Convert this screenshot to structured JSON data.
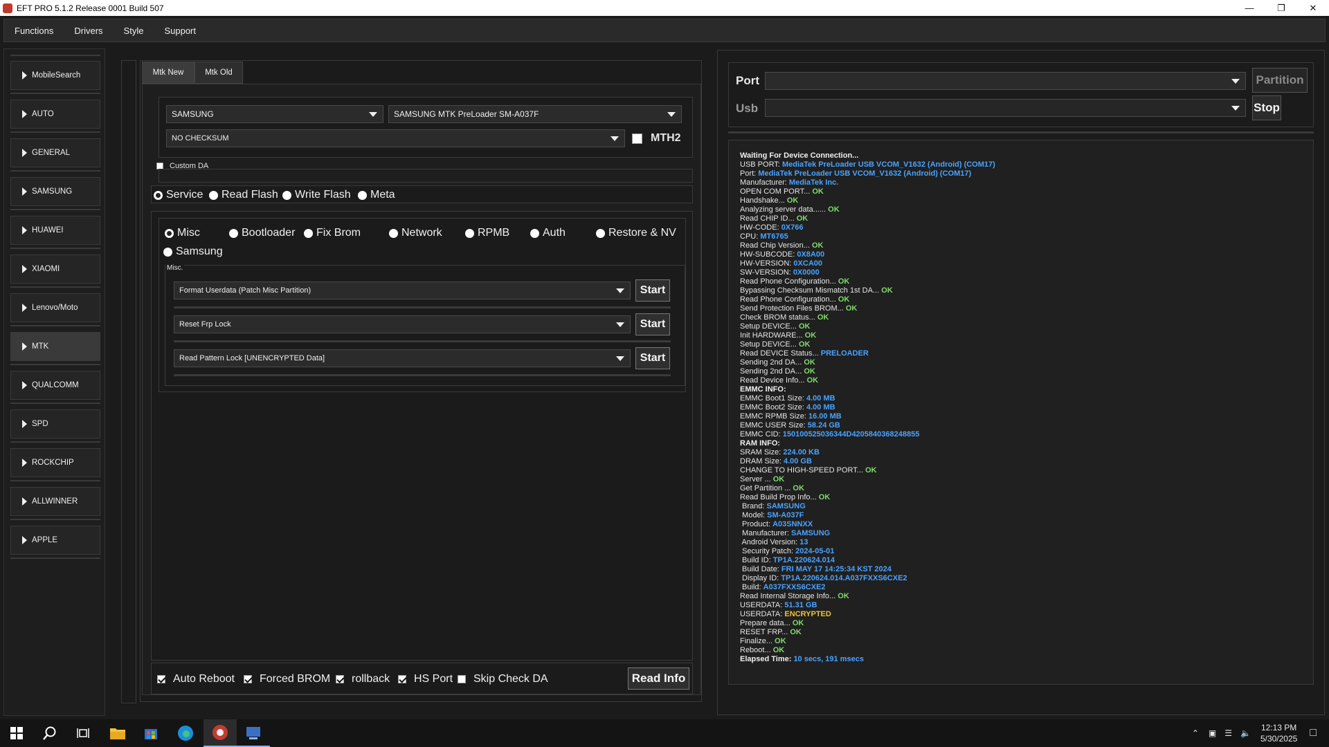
{
  "window": {
    "title": "EFT PRO 5.1.2 Release 0001 Build 507"
  },
  "menu": [
    "Functions",
    "Drivers",
    "Style",
    "Support"
  ],
  "sidebar": {
    "items": [
      {
        "label": "MobileSearch"
      },
      {
        "label": "AUTO"
      },
      {
        "label": "GENERAL"
      },
      {
        "label": "SAMSUNG"
      },
      {
        "label": "HUAWEI"
      },
      {
        "label": "XIAOMI"
      },
      {
        "label": "Lenovo/Moto"
      },
      {
        "label": "MTK"
      },
      {
        "label": "QUALCOMM"
      },
      {
        "label": "SPD"
      },
      {
        "label": "ROCKCHIP"
      },
      {
        "label": "ALLWINNER"
      },
      {
        "label": "APPLE"
      }
    ],
    "active": "MTK"
  },
  "tabs": {
    "mtk_new": "Mtk New",
    "mtk_old": "Mtk Old"
  },
  "config": {
    "brand": "SAMSUNG",
    "model": "SAMSUNG MTK PreLoader SM-A037F",
    "checksum": "NO CHECKSUM",
    "mth2_label": "MTH2",
    "custom_da_label": "Custom DA"
  },
  "modes": {
    "service": "Service",
    "read_flash": "Read Flash",
    "write_flash": "Write Flash",
    "meta": "Meta",
    "selected": "Service"
  },
  "categories": {
    "misc": "Misc",
    "bootloader": "Bootloader",
    "fix_brom": "Fix Brom",
    "network": "Network",
    "rpmb": "RPMB",
    "auth": "Auth",
    "restore_nv": "Restore & NV",
    "samsung": "Samsung",
    "selected": "Misc"
  },
  "misc": {
    "group_label": "Misc.",
    "op1": "Format Userdata (Patch Misc Partition)",
    "op2": "Reset Frp Lock",
    "op3": "Read Pattern Lock [UNENCRYPTED Data]",
    "start": "Start"
  },
  "options": {
    "auto_reboot": "Auto Reboot",
    "forced_brom": "Forced BROM",
    "rollback": "rollback",
    "hs_port": "HS Port",
    "skip_check_da": "Skip Check DA",
    "read_info": "Read Info"
  },
  "port": {
    "port_label": "Port",
    "usb_label": "Usb",
    "partition": "Partition",
    "stop": "Stop"
  },
  "colors": {
    "info_blue": "#4aa3ff",
    "ok_green": "#7fdc6a",
    "warn_yellow": "#f1c232"
  },
  "log": [
    [
      {
        "t": "Waiting For Device Connection...",
        "c": "h"
      }
    ],
    [
      {
        "t": "USB PORT: "
      },
      {
        "t": "MediaTek PreLoader USB VCOM_V1632 (Android) (COM17)",
        "c": "b"
      }
    ],
    [
      {
        "t": "Port: "
      },
      {
        "t": "MediaTek PreLoader USB VCOM_V1632 (Android) (COM17)",
        "c": "b"
      }
    ],
    [
      {
        "t": "Manufacturer: "
      },
      {
        "t": "MediaTek Inc.",
        "c": "b"
      }
    ],
    [
      {
        "t": "OPEN COM PORT... "
      },
      {
        "t": "OK",
        "c": "g"
      }
    ],
    [
      {
        "t": "Handshake... "
      },
      {
        "t": "OK",
        "c": "g"
      }
    ],
    [
      {
        "t": "Analyzing server data...... "
      },
      {
        "t": "OK",
        "c": "g"
      }
    ],
    [
      {
        "t": "Read CHIP ID... "
      },
      {
        "t": "OK",
        "c": "g"
      }
    ],
    [
      {
        "t": "HW-CODE: "
      },
      {
        "t": "0X766",
        "c": "b"
      }
    ],
    [
      {
        "t": "CPU: "
      },
      {
        "t": "MT6765",
        "c": "b"
      }
    ],
    [
      {
        "t": "Read Chip Version... "
      },
      {
        "t": "OK",
        "c": "g"
      }
    ],
    [
      {
        "t": "HW-SUBCODE: "
      },
      {
        "t": "0X8A00",
        "c": "b"
      }
    ],
    [
      {
        "t": "HW-VERSION: "
      },
      {
        "t": "0XCA00",
        "c": "b"
      }
    ],
    [
      {
        "t": "SW-VERSION: "
      },
      {
        "t": "0X0000",
        "c": "b"
      }
    ],
    [
      {
        "t": "Read Phone Configuration... "
      },
      {
        "t": "OK",
        "c": "g"
      }
    ],
    [
      {
        "t": "Bypassing Checksum Mismatch 1st DA... "
      },
      {
        "t": "OK",
        "c": "g"
      }
    ],
    [
      {
        "t": "Read Phone Configuration... "
      },
      {
        "t": "OK",
        "c": "g"
      }
    ],
    [
      {
        "t": "Send Protection Files BROM... "
      },
      {
        "t": "OK",
        "c": "g"
      }
    ],
    [
      {
        "t": "Check BROM status... "
      },
      {
        "t": "OK",
        "c": "g"
      }
    ],
    [
      {
        "t": "Setup DEVICE... "
      },
      {
        "t": "OK",
        "c": "g"
      }
    ],
    [
      {
        "t": "Init HARDWARE... "
      },
      {
        "t": "OK",
        "c": "g"
      }
    ],
    [
      {
        "t": "Setup DEVICE... "
      },
      {
        "t": "OK",
        "c": "g"
      }
    ],
    [
      {
        "t": "Read DEVICE Status... "
      },
      {
        "t": "PRELOADER",
        "c": "b"
      }
    ],
    [
      {
        "t": "Sending 2nd DA... "
      },
      {
        "t": "OK",
        "c": "g"
      }
    ],
    [
      {
        "t": "Sending 2nd DA... "
      },
      {
        "t": "OK",
        "c": "g"
      }
    ],
    [
      {
        "t": "Read Device Info... "
      },
      {
        "t": "OK",
        "c": "g"
      }
    ],
    [
      {
        "t": "EMMC INFO:",
        "c": "h"
      }
    ],
    [
      {
        "t": "EMMC Boot1 Size: "
      },
      {
        "t": "4.00 MB",
        "c": "b"
      }
    ],
    [
      {
        "t": "EMMC Boot2 Size: "
      },
      {
        "t": "4.00 MB",
        "c": "b"
      }
    ],
    [
      {
        "t": "EMMC RPMB Size: "
      },
      {
        "t": "16.00 MB",
        "c": "b"
      }
    ],
    [
      {
        "t": "EMMC USER Size: "
      },
      {
        "t": "58.24 GB",
        "c": "b"
      }
    ],
    [
      {
        "t": "EMMC CID: "
      },
      {
        "t": "150100525036344D4205840368248855",
        "c": "b"
      }
    ],
    [
      {
        "t": "RAM INFO:",
        "c": "h"
      }
    ],
    [
      {
        "t": "SRAM Size: "
      },
      {
        "t": "224.00 KB",
        "c": "b"
      }
    ],
    [
      {
        "t": "DRAM Size: "
      },
      {
        "t": "4.00 GB",
        "c": "b"
      }
    ],
    [
      {
        "t": "CHANGE TO HIGH-SPEED PORT... "
      },
      {
        "t": "OK",
        "c": "g"
      }
    ],
    [
      {
        "t": "Server ... "
      },
      {
        "t": "OK",
        "c": "g"
      }
    ],
    [
      {
        "t": "Get Partition ... "
      },
      {
        "t": "OK",
        "c": "g"
      }
    ],
    [
      {
        "t": "Read Build Prop Info... "
      },
      {
        "t": "OK",
        "c": "g"
      }
    ],
    [
      {
        "t": " Brand: "
      },
      {
        "t": "SAMSUNG",
        "c": "b"
      }
    ],
    [
      {
        "t": " Model: "
      },
      {
        "t": "SM-A037F",
        "c": "b"
      }
    ],
    [
      {
        "t": " Product: "
      },
      {
        "t": "A03SNNXX",
        "c": "b"
      }
    ],
    [
      {
        "t": " Manufacturer: "
      },
      {
        "t": "SAMSUNG",
        "c": "b"
      }
    ],
    [
      {
        "t": " Android Version: "
      },
      {
        "t": "13",
        "c": "b"
      }
    ],
    [
      {
        "t": " Security Patch: "
      },
      {
        "t": "2024-05-01",
        "c": "b"
      }
    ],
    [
      {
        "t": " Build ID: "
      },
      {
        "t": "TP1A.220624.014",
        "c": "b"
      }
    ],
    [
      {
        "t": " Build Date: "
      },
      {
        "t": "FRI MAY 17 14:25:34 KST 2024",
        "c": "b"
      }
    ],
    [
      {
        "t": " Display ID: "
      },
      {
        "t": "TP1A.220624.014.A037FXXS6CXE2",
        "c": "b"
      }
    ],
    [
      {
        "t": " Build: "
      },
      {
        "t": "A037FXXS6CXE2",
        "c": "b"
      }
    ],
    [
      {
        "t": "Read Internal Storage Info... "
      },
      {
        "t": "OK",
        "c": "g"
      }
    ],
    [
      {
        "t": "USERDATA: "
      },
      {
        "t": "51.31 GB",
        "c": "b"
      }
    ],
    [
      {
        "t": "USERDATA: "
      },
      {
        "t": "ENCRYPTED",
        "c": "y"
      }
    ],
    [
      {
        "t": "Prepare data... "
      },
      {
        "t": "OK",
        "c": "g"
      }
    ],
    [
      {
        "t": "RESET FRP... "
      },
      {
        "t": "OK",
        "c": "g"
      }
    ],
    [
      {
        "t": "Finalize... "
      },
      {
        "t": "OK",
        "c": "g"
      }
    ],
    [
      {
        "t": "Reboot... "
      },
      {
        "t": "OK",
        "c": "g"
      }
    ],
    [
      {
        "t": "Elapsed Time: ",
        "c": "h"
      },
      {
        "t": "10 secs, 191 msecs",
        "c": "b"
      }
    ]
  ],
  "taskbar": {
    "time": "12:13 PM",
    "date": "5/30/2025"
  }
}
